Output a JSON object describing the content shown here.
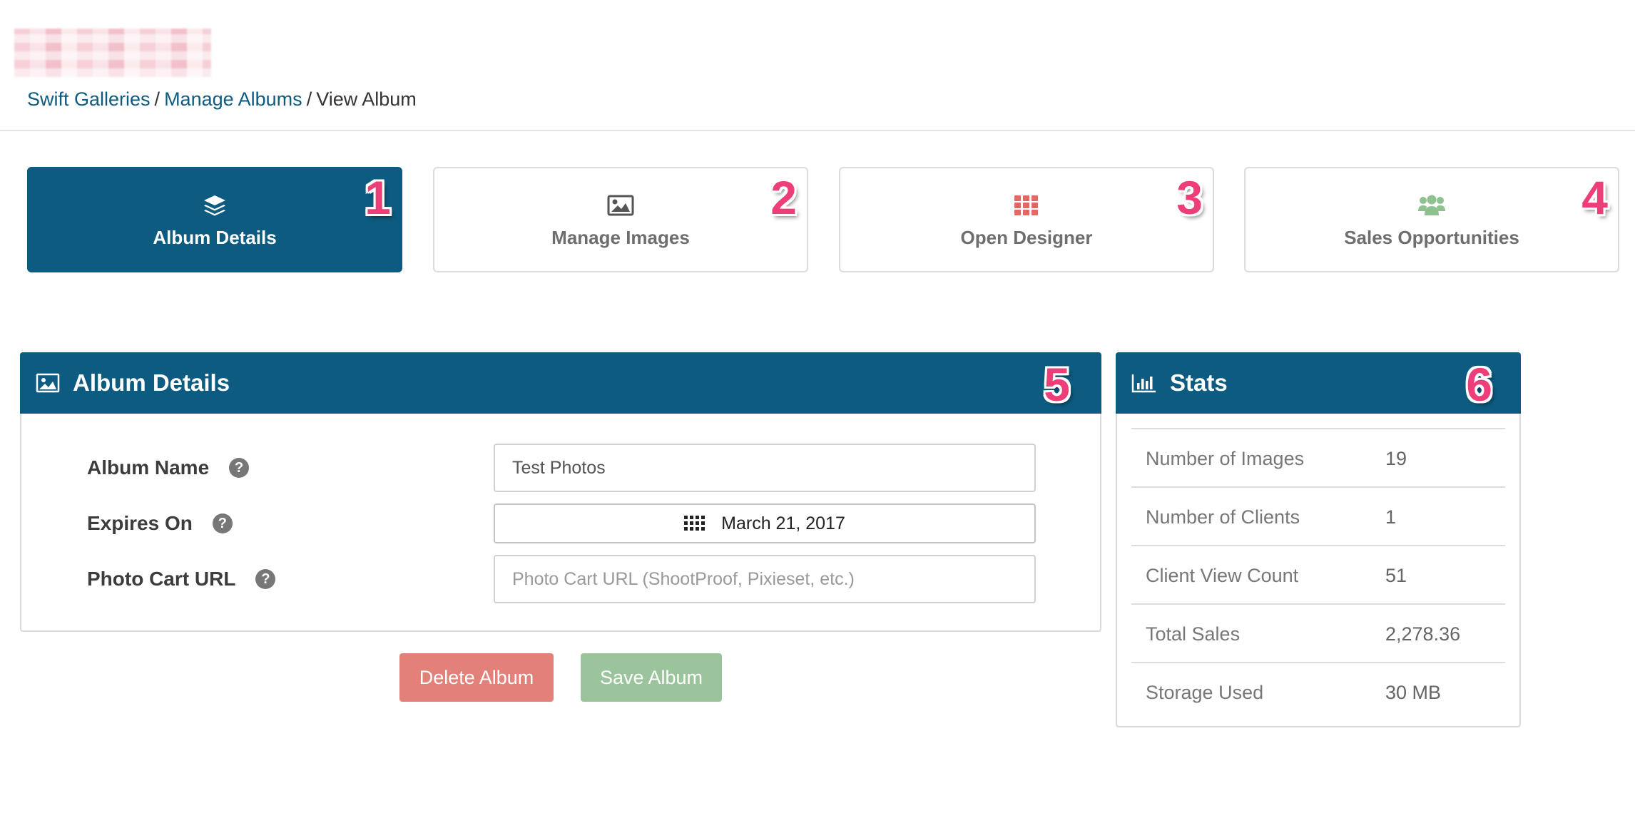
{
  "breadcrumb": {
    "items": [
      "Swift Galleries",
      "Manage Albums",
      "View Album"
    ],
    "separator": "/"
  },
  "nav_tiles": [
    {
      "label": "Album Details",
      "icon": "layers-icon",
      "marker": "1",
      "active": true
    },
    {
      "label": "Manage Images",
      "icon": "image-icon",
      "marker": "2",
      "active": false
    },
    {
      "label": "Open Designer",
      "icon": "grid-icon",
      "marker": "3",
      "active": false
    },
    {
      "label": "Sales Opportunities",
      "icon": "users-icon",
      "marker": "4",
      "active": false
    }
  ],
  "details_panel": {
    "title": "Album Details",
    "icon": "picture-icon",
    "marker": "5",
    "fields": {
      "album_name": {
        "label": "Album Name",
        "value": "Test Photos"
      },
      "expires_on": {
        "label": "Expires On",
        "value": "March 21, 2017"
      },
      "photo_cart_url": {
        "label": "Photo Cart URL",
        "value": "",
        "placeholder": "Photo Cart URL (ShootProof, Pixieset, etc.)"
      }
    },
    "help_glyph": "?"
  },
  "buttons": {
    "delete_label": "Delete Album",
    "save_label": "Save Album"
  },
  "stats_panel": {
    "title": "Stats",
    "icon": "bar-chart-icon",
    "marker": "6",
    "rows": [
      {
        "label": "Number of Images",
        "value": "19"
      },
      {
        "label": "Number of Clients",
        "value": "1"
      },
      {
        "label": "Client View Count",
        "value": "51"
      },
      {
        "label": "Total Sales",
        "value": "2,278.36"
      },
      {
        "label": "Storage Used",
        "value": "30 MB"
      }
    ]
  },
  "colors": {
    "primary": "#0d5b80",
    "link": "#0d5b80",
    "marker": "#ee3e7a",
    "delete": "#e2807a",
    "save": "#9bc39c",
    "designer_icon": "#e06a63",
    "users_icon": "#8fc08f"
  }
}
